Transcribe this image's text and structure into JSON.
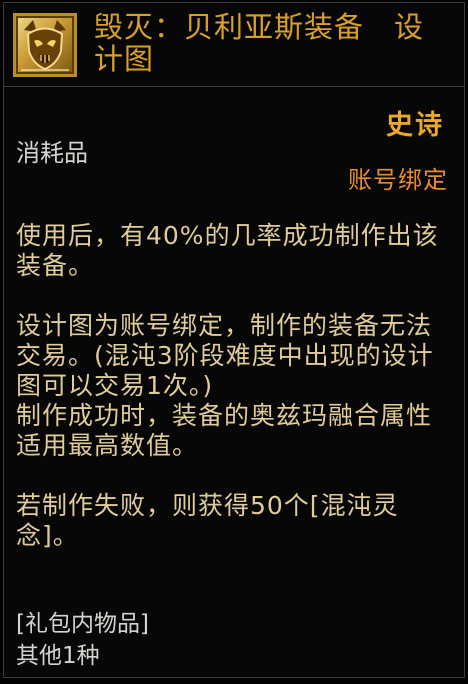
{
  "tooltip": {
    "icon": "demon-skull-blueprint-icon",
    "title": "毁灭：贝利亚斯装备　设计图",
    "rarity": "史诗",
    "item_type": "消耗品",
    "binding": "账号绑定",
    "description": [
      "使用后，有40%的几率成功制作出该装备。",
      "设计图为账号绑定，制作的装备无法交易。(混沌3阶段难度中出现的设计图可以交易1次。)",
      "制作成功时，装备的奥兹玛融合属性适用最高数值。",
      "若制作失败，则获得50个[混沌灵念]。"
    ],
    "contents_title": "[礼包内物品]",
    "contents_item": "其他1种"
  },
  "colors": {
    "title": "#d8a028",
    "rarity_epic": "#e9a92b",
    "binding": "#e78b30",
    "description": "#e0cc98",
    "neutral_text": "#d3d3cf",
    "background": "#070707"
  }
}
